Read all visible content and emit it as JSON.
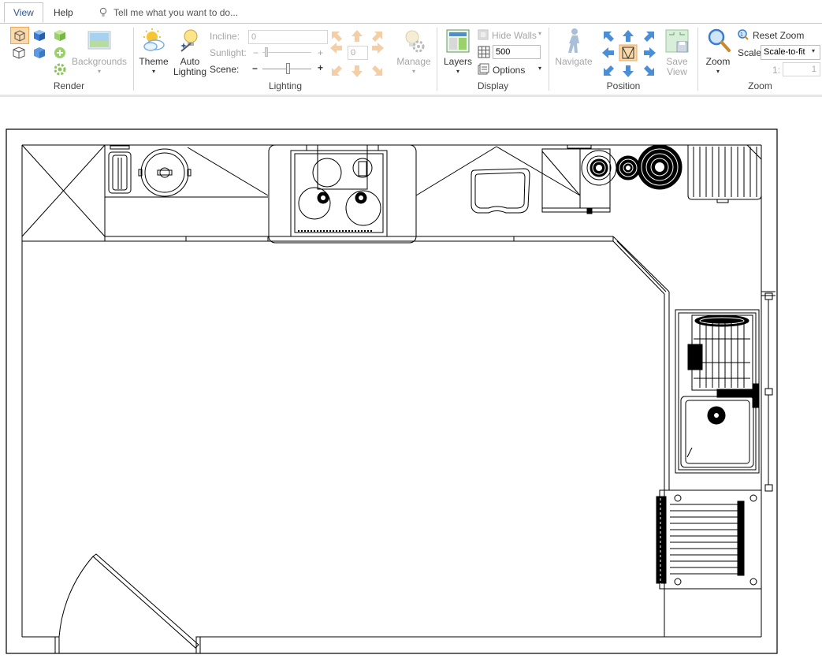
{
  "tabs": {
    "view": "View",
    "help": "Help"
  },
  "tell_me": {
    "placeholder": "Tell me what you want to do..."
  },
  "render": {
    "backgrounds_label": "Backgrounds",
    "group_label": "Render"
  },
  "lighting": {
    "theme_label": "Theme",
    "auto_lighting_line1": "Auto",
    "auto_lighting_line2": "Lighting",
    "incline_label": "Incline:",
    "incline_value": "0",
    "sunlight_label": "Sunlight:",
    "sunlight_value": "0",
    "scene_label": "Scene:",
    "scene_minus": "−",
    "scene_plus": "+",
    "sun_minus": "−",
    "sun_plus": "+",
    "manage_label": "Manage",
    "group_label": "Lighting"
  },
  "display": {
    "hide_walls_label": "Hide Walls",
    "layers_label": "Layers",
    "grid_value": "500",
    "options_label": "Options",
    "group_label": "Display"
  },
  "position": {
    "navigate_label": "Navigate",
    "save_view_line1": "Save",
    "save_view_line2": "View",
    "group_label": "Position"
  },
  "zoom": {
    "zoom_label": "Zoom",
    "reset_zoom_label": "Reset Zoom",
    "scale_label": "Scale:",
    "scale_value": "Scale-to-fit",
    "ratio_label": "1:",
    "ratio_value": "1",
    "group_label": "Zoom"
  },
  "colors": {
    "accent": "#2b579a",
    "selected_bg": "#fbd9a8",
    "disabled_arrow": "#f2c9a0",
    "active_arrow": "#4a8fd6"
  }
}
